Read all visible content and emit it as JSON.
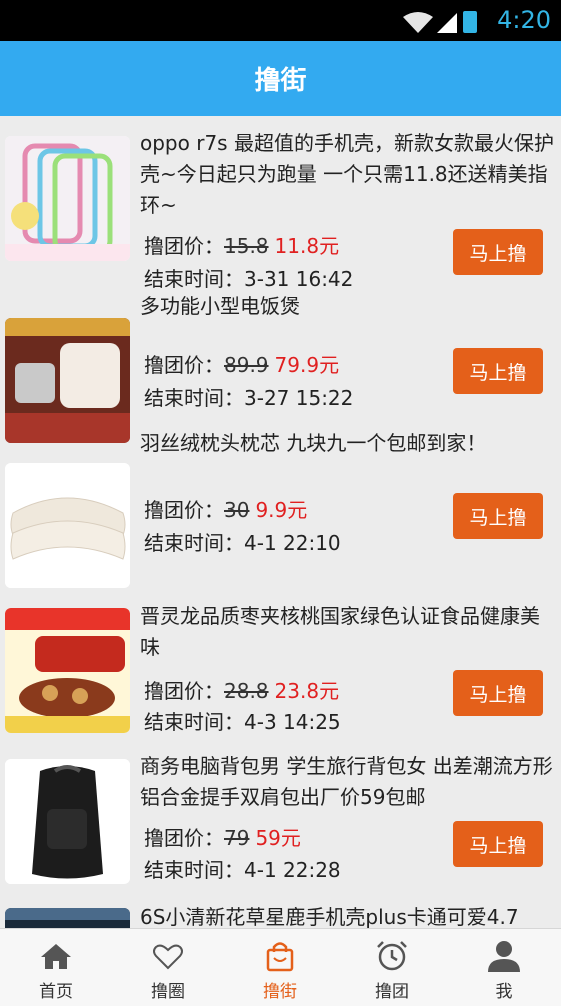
{
  "status_bar": {
    "time": "4:20"
  },
  "header": {
    "title": "撸街"
  },
  "labels": {
    "price_prefix": "撸团价：",
    "end_prefix": "结束时间：",
    "button": "马上撸"
  },
  "items": [
    {
      "title": "oppo r7s 最超值的手机壳，新款女款最火保护壳~今日起只为跑量 一个只需11.8还送精美指环~",
      "original_price": "15.8",
      "price": "11.8元",
      "end_time": "3-31 16:42"
    },
    {
      "title": "多功能小型电饭煲",
      "original_price": "89.9",
      "price": "79.9元",
      "end_time": "3-27 15:22"
    },
    {
      "title": "羽丝绒枕头枕芯 九块九一个包邮到家！",
      "original_price": "30",
      "price": "9.9元",
      "end_time": "4-1 22:10"
    },
    {
      "title": "晋灵龙品质枣夹核桃国家绿色认证食品健康美味",
      "original_price": "28.8",
      "price": "23.8元",
      "end_time": "4-3 14:25"
    },
    {
      "title": "商务电脑背包男 学生旅行背包女 出差潮流方形铝合金提手双肩包出厂价59包邮",
      "original_price": "79",
      "price": "59元",
      "end_time": "4-1 22:28"
    },
    {
      "title": "6S小清新花草星鹿手机壳plus卡通可爱4.7"
    }
  ],
  "tabs": [
    {
      "label": "首页",
      "icon": "home-icon"
    },
    {
      "label": "撸圈",
      "icon": "heart-icon"
    },
    {
      "label": "撸街",
      "icon": "shopping-bag-icon",
      "active": true
    },
    {
      "label": "撸团",
      "icon": "alarm-clock-icon"
    },
    {
      "label": "我",
      "icon": "person-icon"
    }
  ],
  "colors": {
    "header": "#33aaf0",
    "accent": "#e4601a",
    "price": "#e02020",
    "status_time": "#33b5e5"
  }
}
